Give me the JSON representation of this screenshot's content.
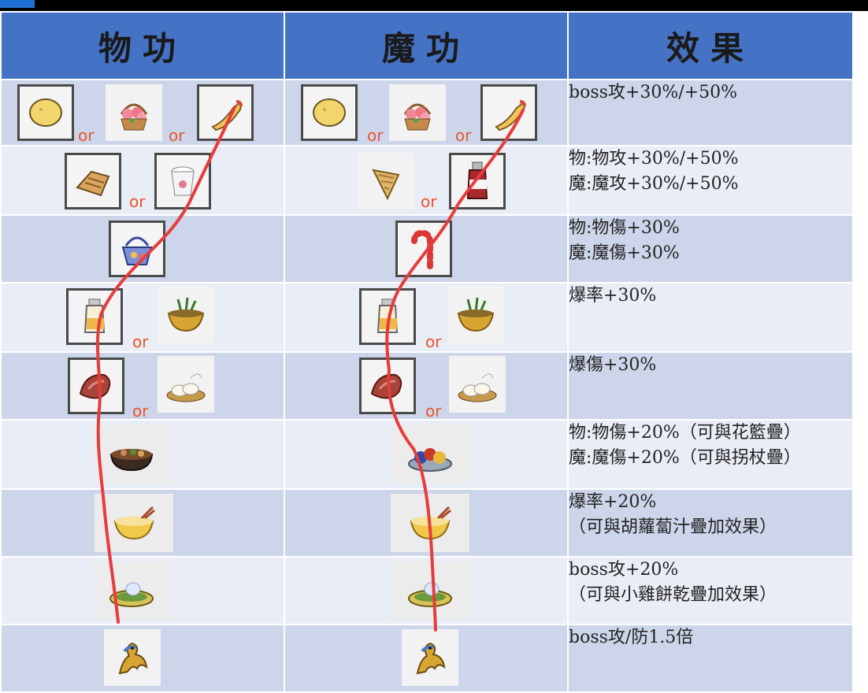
{
  "header": {
    "physical": "物功",
    "magic": "魔功",
    "effect": "效果"
  },
  "or_label": "or",
  "rows": [
    {
      "effect": [
        "boss攻+30%/+50%"
      ]
    },
    {
      "effect": [
        "物:物攻+30%/+50%",
        "魔:魔攻+30%/+50%"
      ]
    },
    {
      "effect": [
        "物:物傷+30%",
        "魔:魔傷+30%"
      ]
    },
    {
      "effect": [
        "爆率+30%"
      ]
    },
    {
      "effect": [
        "爆傷+30%"
      ]
    },
    {
      "effect": [
        "物:物傷+20%（可與花籃疊）",
        "魔:魔傷+20%（可與拐杖疊）"
      ]
    },
    {
      "effect": [
        "爆率+20%",
        "（可與胡蘿蔔汁疊加效果）"
      ]
    },
    {
      "effect": [
        "boss攻+20%",
        "（可與小雞餅乾疊加效果）"
      ]
    },
    {
      "effect": [
        "boss攻/防1.5倍"
      ]
    }
  ],
  "icons": {
    "physical": [
      [
        "potato-chip-icon",
        "flower-basket-icon",
        "churro-icon"
      ],
      [
        "bread-icon",
        "yogurt-cup-icon"
      ],
      [
        "blue-basket-icon"
      ],
      [
        "juice-bottle-icon",
        "herb-pot-icon"
      ],
      [
        "meat-icon",
        "dumpling-plate-icon"
      ],
      [
        "stew-pot-icon"
      ],
      [
        "noodle-bowl-icon"
      ],
      [
        "salad-plate-icon"
      ],
      [
        "dragon-figure-icon"
      ]
    ],
    "magic": [
      [
        "potato-chip-icon",
        "flower-basket-icon",
        "churro-icon"
      ],
      [
        "cone-cookie-icon",
        "sauce-bottle-icon"
      ],
      [
        "candy-cane-icon"
      ],
      [
        "juice-bottle-icon",
        "herb-pot-icon"
      ],
      [
        "meat-icon",
        "dumpling-plate-icon"
      ],
      [
        "fruit-platter-icon"
      ],
      [
        "noodle-bowl-icon"
      ],
      [
        "salad-plate-icon"
      ],
      [
        "dragon-figure-icon"
      ]
    ]
  },
  "colors": {
    "header_bg": "#4472c4",
    "row_dark": "#cdd5ea",
    "row_light": "#e9edf6",
    "or_text": "#e8552b",
    "trail": "#e63c3c"
  }
}
